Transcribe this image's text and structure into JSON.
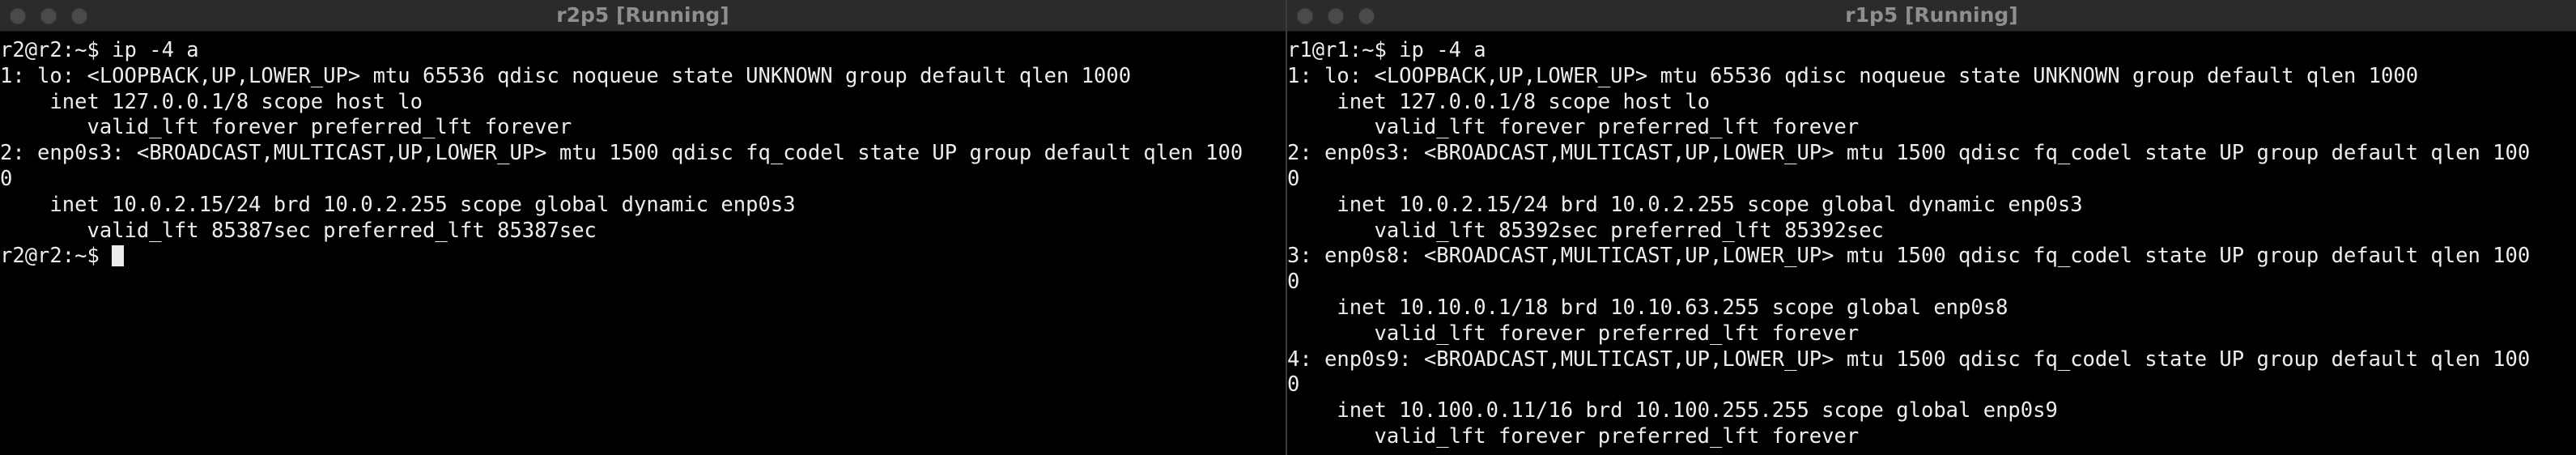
{
  "windows": {
    "left": {
      "title": "r2p5 [Running]",
      "lines": [
        "r2@r2:~$ ip -4 a",
        "1: lo: <LOOPBACK,UP,LOWER_UP> mtu 65536 qdisc noqueue state UNKNOWN group default qlen 1000",
        "    inet 127.0.0.1/8 scope host lo",
        "       valid_lft forever preferred_lft forever",
        "2: enp0s3: <BROADCAST,MULTICAST,UP,LOWER_UP> mtu 1500 qdisc fq_codel state UP group default qlen 100",
        "0",
        "    inet 10.0.2.15/24 brd 10.0.2.255 scope global dynamic enp0s3",
        "       valid_lft 85387sec preferred_lft 85387sec",
        "r2@r2:~$ "
      ]
    },
    "right": {
      "title": "r1p5 [Running]",
      "lines": [
        "r1@r1:~$ ip -4 a",
        "1: lo: <LOOPBACK,UP,LOWER_UP> mtu 65536 qdisc noqueue state UNKNOWN group default qlen 1000",
        "    inet 127.0.0.1/8 scope host lo",
        "       valid_lft forever preferred_lft forever",
        "2: enp0s3: <BROADCAST,MULTICAST,UP,LOWER_UP> mtu 1500 qdisc fq_codel state UP group default qlen 100",
        "0",
        "    inet 10.0.2.15/24 brd 10.0.2.255 scope global dynamic enp0s3",
        "       valid_lft 85392sec preferred_lft 85392sec",
        "3: enp0s8: <BROADCAST,MULTICAST,UP,LOWER_UP> mtu 1500 qdisc fq_codel state UP group default qlen 100",
        "0",
        "    inet 10.10.0.1/18 brd 10.10.63.255 scope global enp0s8",
        "       valid_lft forever preferred_lft forever",
        "4: enp0s9: <BROADCAST,MULTICAST,UP,LOWER_UP> mtu 1500 qdisc fq_codel state UP group default qlen 100",
        "0",
        "    inet 10.100.0.11/16 brd 10.100.255.255 scope global enp0s9",
        "       valid_lft forever preferred_lft forever"
      ]
    }
  },
  "colors": {
    "background": "#000000",
    "text": "#ededed",
    "titlebar": "#2b2b2b",
    "title_text": "#8f8f8f",
    "traffic_light": "#4a4a4a"
  }
}
